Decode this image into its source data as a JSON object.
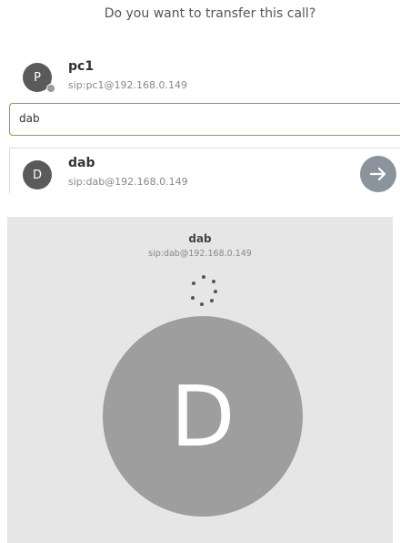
{
  "dialog": {
    "title": "Do you want to transfer this call?"
  },
  "current_call": {
    "initial": "P",
    "name": "pc1",
    "address": "sip:pc1@192.168.0.149"
  },
  "search": {
    "value": "dab"
  },
  "results": [
    {
      "initial": "D",
      "name": "dab",
      "address": "sip:dab@192.168.0.149"
    }
  ],
  "calling_panel": {
    "name": "dab",
    "address": "sip:dab@192.168.0.149",
    "avatar_initial": "D"
  },
  "icons": {
    "transfer": "arrow-right-icon",
    "loading": "spinner-icon",
    "presence": "status-dot-icon"
  }
}
